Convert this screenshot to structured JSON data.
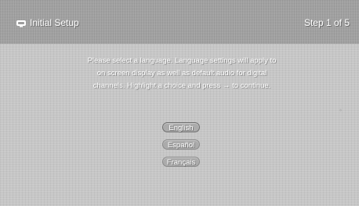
{
  "header": {
    "title": "Initial Setup",
    "step": "Step 1 of 5",
    "icon": "tv-icon"
  },
  "instructions": {
    "line1": "Please select a language. Language settings will apply to",
    "line2": "on screen display as well as default audio for digital",
    "line3": "channels. Highlight a choice and press → to continue."
  },
  "languages": {
    "options": [
      "English",
      "Español",
      "Français"
    ],
    "selected": "English"
  },
  "colors": {
    "background": "#c6c6c6",
    "header": "#9d9d9d",
    "text": "#ffffff"
  }
}
